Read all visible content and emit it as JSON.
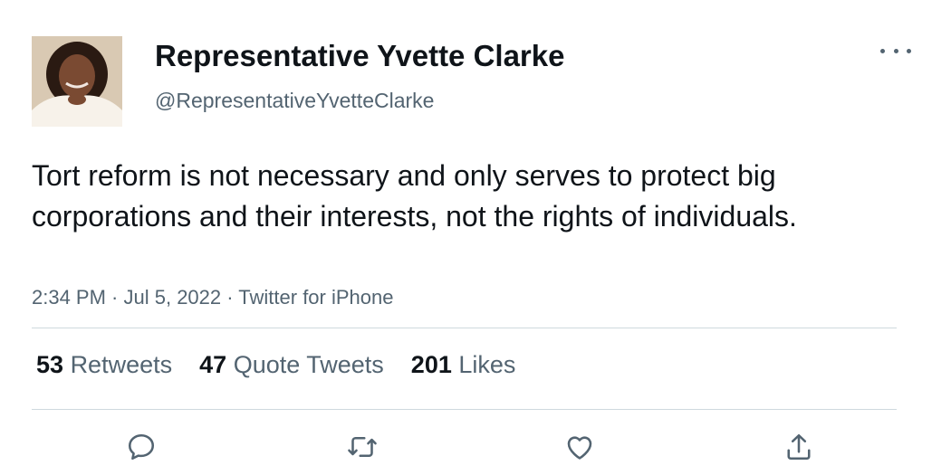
{
  "author": {
    "display_name": "Representative Yvette Clarke",
    "handle": "@RepresentativeYvetteClarke"
  },
  "tweet": {
    "text": "Tort reform is not necessary and only serves to protect big corporations and their interests, not the rights of individuals.",
    "time": "2:34 PM",
    "date": "Jul 5, 2022",
    "source": "Twitter for iPhone",
    "separator": " · "
  },
  "stats": {
    "retweets": {
      "count": "53",
      "label": "Retweets"
    },
    "quote_tweets": {
      "count": "47",
      "label": "Quote Tweets"
    },
    "likes": {
      "count": "201",
      "label": "Likes"
    }
  },
  "icons": {
    "more": "more-horizontal-icon",
    "reply": "reply-icon",
    "retweet": "retweet-icon",
    "like": "heart-icon",
    "share": "share-icon"
  },
  "colors": {
    "text_primary": "#0f1419",
    "text_secondary": "#536471",
    "divider": "#cfd9de"
  }
}
